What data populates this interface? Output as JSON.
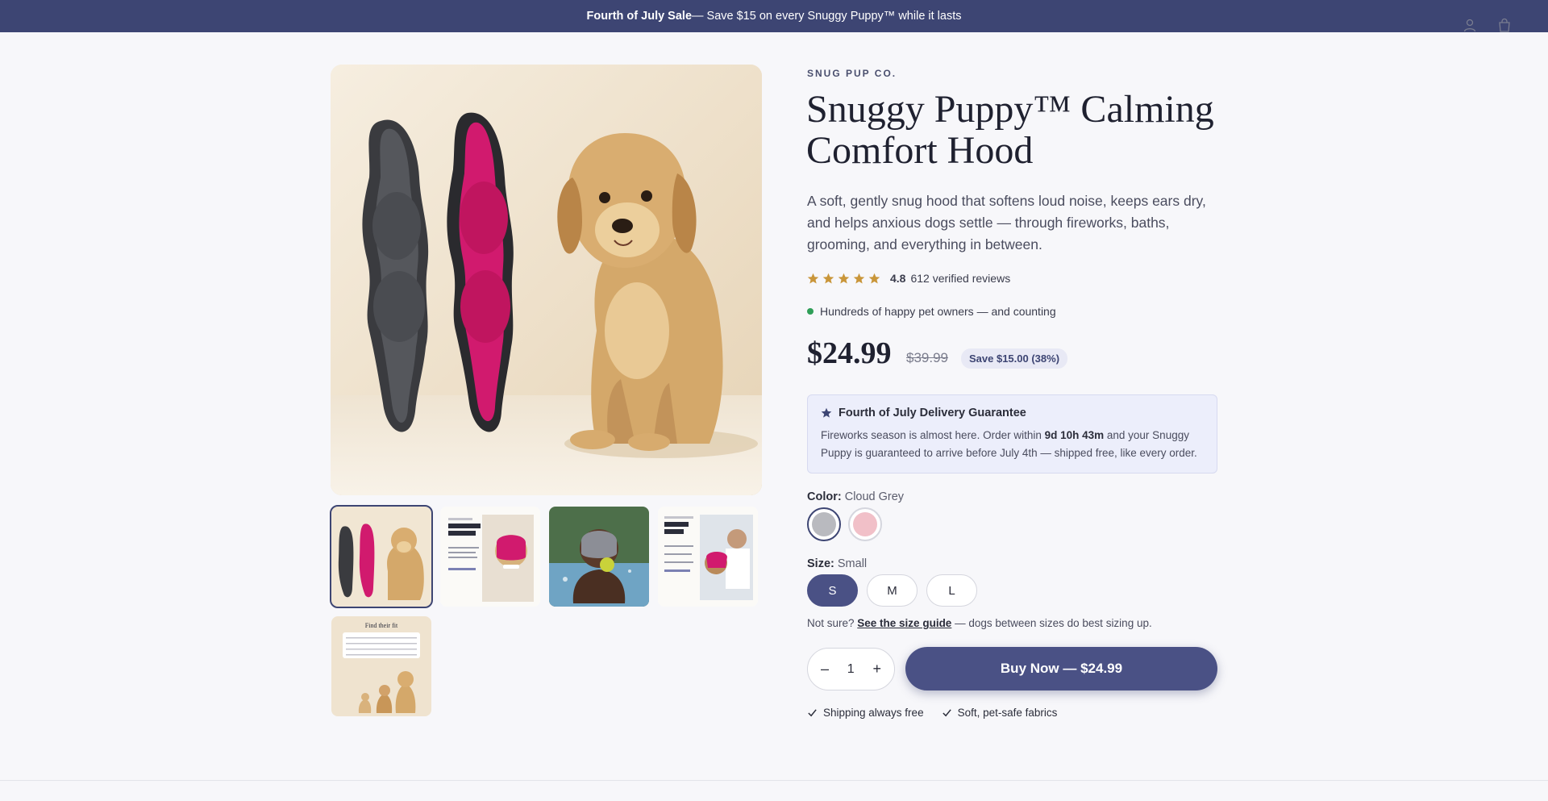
{
  "announcement": {
    "bold": "Fourth of July Sale",
    "rest": " — Save $15 on every Snuggy Puppy™ while it lasts"
  },
  "header": {
    "icons": [
      "account-icon",
      "cart-icon"
    ]
  },
  "product": {
    "brand": "SNUG PUP CO.",
    "title": "Snuggy Puppy™ Calming Comfort Hood",
    "description": "A soft, gently snug hood that softens loud noise, keeps ears dry, and helps anxious dogs settle — through fireworks, baths, grooming, and everything in between.",
    "rating": {
      "score": "4.8",
      "reviews": "612 verified reviews",
      "stars": 5
    },
    "social_proof": "Hundreds of happy pet owners — and counting",
    "price": "$24.99",
    "compare_price": "$39.99",
    "save_badge": "Save $15.00 (38%)"
  },
  "guarantee": {
    "title": "Fourth of July Delivery Guarantee",
    "body_pre": "Fireworks season is almost here. Order within ",
    "countdown": "9d 10h 43m",
    "body_post": " and your Snuggy Puppy is guaranteed to arrive before July 4th — shipped free, like every order."
  },
  "gallery": {
    "thumb_5_title": "Find their fit"
  },
  "options": {
    "color_label": "Color:",
    "color_value": "Cloud Grey",
    "colors": [
      {
        "name": "Cloud Grey",
        "hex": "#b9babf"
      },
      {
        "name": "Blush Pink",
        "hex": "#f1c0c8"
      }
    ],
    "size_label": "Size:",
    "size_value": "Small",
    "sizes": [
      "S",
      "M",
      "L"
    ],
    "size_note_pre": "Not sure? ",
    "size_note_link": "See the size guide",
    "size_note_post": " — dogs between sizes do best sizing up."
  },
  "purchase": {
    "qty_minus": "–",
    "qty_value": "1",
    "qty_plus": "+",
    "buy_label": "Buy Now — $24.99"
  },
  "perks": [
    "Shipping always free",
    "Soft, pet-safe fabrics"
  ],
  "colors": {
    "accent": "#3d4573",
    "button": "#4a5185",
    "star": "#c9963a",
    "success": "#2f9e57"
  }
}
